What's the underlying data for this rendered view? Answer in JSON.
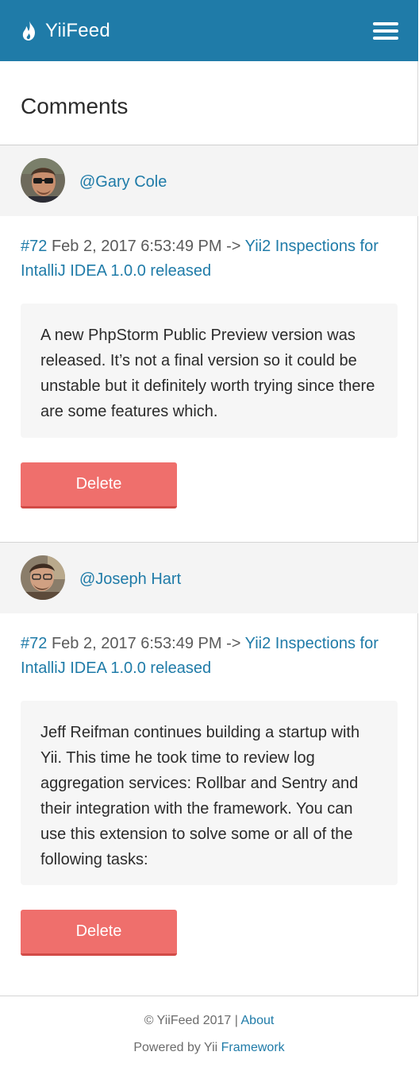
{
  "header": {
    "brand": "YiiFeed",
    "brand_icon": "flame-icon",
    "menu_icon": "hamburger-menu-icon",
    "color": "#1f7ba8"
  },
  "page": {
    "title": "Comments"
  },
  "comments": [
    {
      "author": "@Gary Cole",
      "id": "#72",
      "date": "Feb 2, 2017 6:53:49 PM",
      "arrow": "->",
      "post_title": "Yii2 Inspections for IntalliJ IDEA 1.0.0 released",
      "body": "A new PhpStorm Public Preview version was released. It’s not a final version so it could be unstable but it definitely worth trying since there are some features which.",
      "delete_label": "Delete"
    },
    {
      "author": "@Joseph Hart",
      "id": "#72",
      "date": "Feb 2, 2017 6:53:49 PM",
      "arrow": "->",
      "post_title": "Yii2 Inspections for IntalliJ IDEA 1.0.0 released",
      "body": "Jeff Reifman continues building a startup with Yii. This time he took time to review log aggregation services: Rollbar and Sentry and their integration with the framework. You can use this extension to solve some or all of the following tasks:",
      "delete_label": "Delete"
    }
  ],
  "footer": {
    "copyright": "© YiiFeed 2017",
    "pipe": "|",
    "about": "About",
    "powered": "Powered by Yii",
    "framework": "Framework"
  },
  "colors": {
    "accent": "#1f7ba8",
    "danger": "#ef6f6c"
  }
}
